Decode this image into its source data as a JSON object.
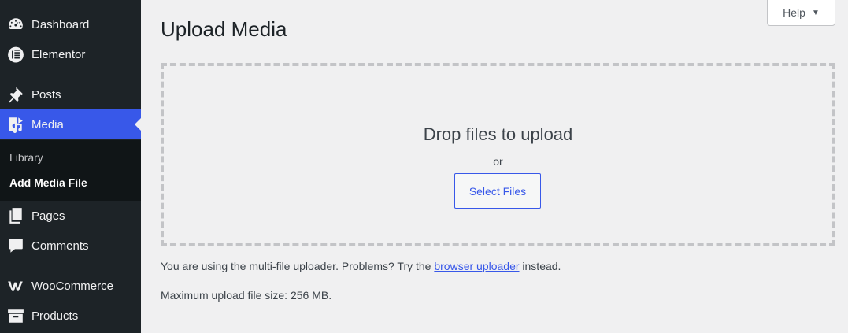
{
  "sidebar": {
    "items": [
      {
        "label": "Dashboard",
        "icon": "dashboard-icon"
      },
      {
        "label": "Elementor",
        "icon": "elementor-icon"
      },
      {
        "label": "Posts",
        "icon": "pin-icon"
      },
      {
        "label": "Media",
        "icon": "media-icon"
      },
      {
        "label": "Pages",
        "icon": "pages-icon"
      },
      {
        "label": "Comments",
        "icon": "comment-icon"
      },
      {
        "label": "WooCommerce",
        "icon": "woocommerce-icon"
      },
      {
        "label": "Products",
        "icon": "archive-icon"
      }
    ],
    "submenu": [
      "Library",
      "Add Media File"
    ]
  },
  "header": {
    "help_label": "Help",
    "help_arrow": "▼"
  },
  "main": {
    "title": "Upload Media",
    "drop_text": "Drop files to upload",
    "or_text": "or",
    "select_label": "Select Files",
    "info_prefix": "You are using the multi-file uploader. Problems? Try the ",
    "info_link": "browser uploader",
    "info_suffix": " instead.",
    "max_size": "Maximum upload file size: 256 MB."
  },
  "colors": {
    "sidebar_bg": "#1d2327",
    "active_bg": "#3858e9",
    "accent": "#3858e9"
  }
}
